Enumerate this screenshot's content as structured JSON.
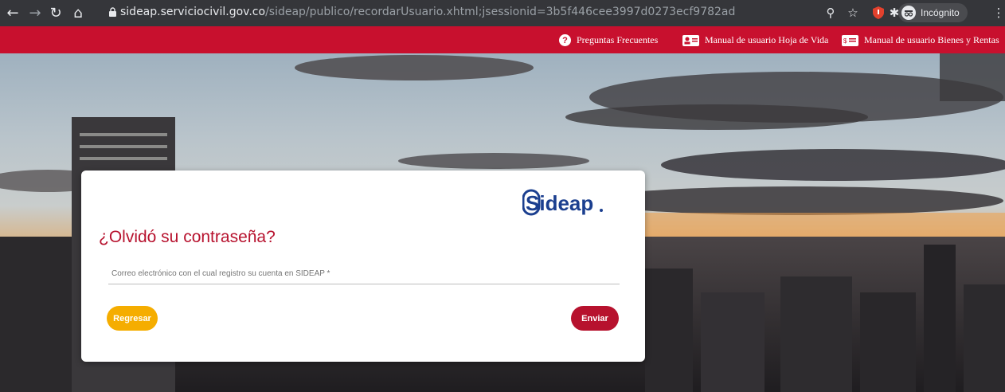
{
  "browser": {
    "url_host": "sideap.serviciocivil.gov.co",
    "url_path": "/sideap/publico/recordarUsuario.xhtml;jsessionid=3b5f446cee3997d0273ecf9782ad",
    "profile_label": "Incógnito"
  },
  "topnav": {
    "faq": "Preguntas Frecuentes",
    "manual_cv": "Manual de usuario Hoja de Vida",
    "manual_assets": "Manual de usuario Bienes y Rentas"
  },
  "form": {
    "logo_text": "Sideap",
    "title": "¿Olvidó su contraseña?",
    "email_label": "Correo electrónico con el cual registro su cuenta en SIDEAP *",
    "back_label": "Regresar",
    "send_label": "Enviar"
  },
  "colors": {
    "brand_red": "#c8102e",
    "title_red": "#b7122e",
    "back_button": "#f5ad00",
    "logo_blue": "#1b3f8f"
  }
}
